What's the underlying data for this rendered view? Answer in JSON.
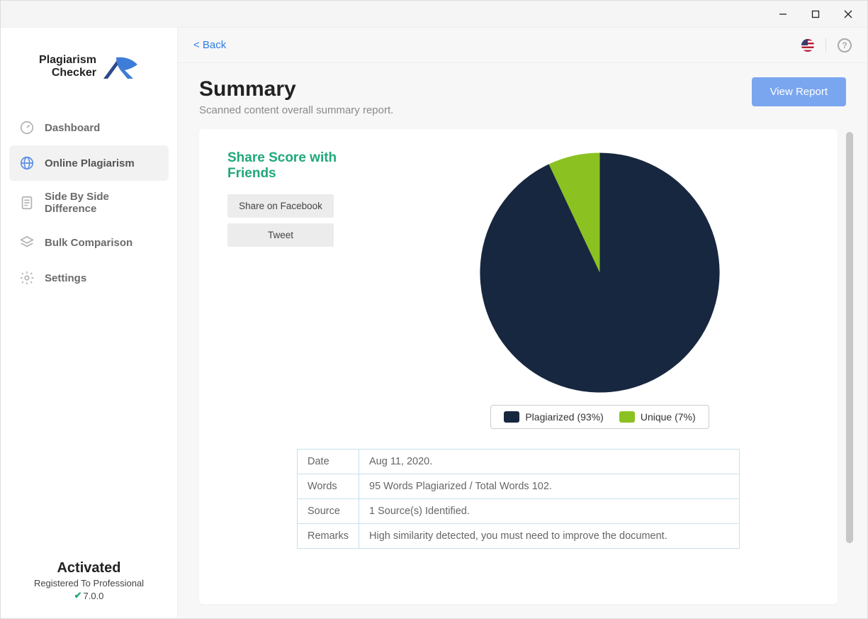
{
  "app": {
    "logo_line1": "Plagiarism",
    "logo_line2": "Checker"
  },
  "sidebar": {
    "items": [
      {
        "label": "Dashboard"
      },
      {
        "label": "Online Plagiarism"
      },
      {
        "label": "Side By Side Difference"
      },
      {
        "label": "Bulk Comparison"
      },
      {
        "label": "Settings"
      }
    ],
    "footer": {
      "activated": "Activated",
      "registered": "Registered To Professional",
      "version": "7.0.0"
    }
  },
  "topbar": {
    "back": "< Back"
  },
  "header": {
    "title": "Summary",
    "subtitle": "Scanned content overall summary report.",
    "view_report": "View Report"
  },
  "share": {
    "title": "Share Score with Friends",
    "facebook": "Share on Facebook",
    "tweet": "Tweet"
  },
  "chart_data": {
    "type": "pie",
    "title": "",
    "series": [
      {
        "name": "Plagiarized",
        "value": 93,
        "color": "#17273f"
      },
      {
        "name": "Unique",
        "value": 7,
        "color": "#8bc221"
      }
    ],
    "legend": [
      {
        "label": "Plagiarized (93%)",
        "color": "#17273f"
      },
      {
        "label": "Unique (7%)",
        "color": "#8bc221"
      }
    ]
  },
  "details": {
    "rows": [
      {
        "k": "Date",
        "v": "Aug 11, 2020."
      },
      {
        "k": "Words",
        "v": "95 Words Plagiarized / Total Words 102."
      },
      {
        "k": "Source",
        "v": "1 Source(s) Identified."
      },
      {
        "k": "Remarks",
        "v": "High similarity detected, you must need to improve the document."
      }
    ]
  }
}
